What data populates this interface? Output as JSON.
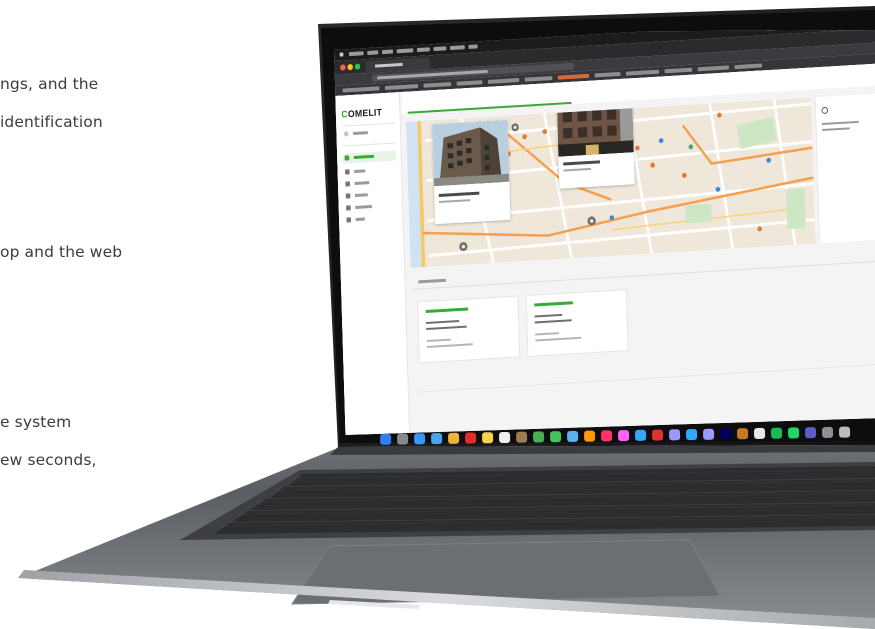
{
  "marketing_copy": {
    "line1": "ngs, and the",
    "line2": "identification",
    "line3": "op and the web",
    "line4": "e system",
    "line5": "ew seconds,"
  },
  "browser": {
    "tab_title": "",
    "url": ""
  },
  "app": {
    "logo": {
      "prefix": "C",
      "rest": "OMELIT"
    },
    "sidebar": {
      "profile_label": "",
      "items": [
        {
          "label": "",
          "active": true
        },
        {
          "label": "",
          "active": false
        },
        {
          "label": "",
          "active": false
        },
        {
          "label": "",
          "active": false
        },
        {
          "label": "",
          "active": false
        },
        {
          "label": "",
          "active": false
        }
      ]
    },
    "page_title": "",
    "map": {
      "cards": [
        {
          "title": "",
          "subtitle": ""
        },
        {
          "title": "",
          "subtitle": ""
        }
      ]
    },
    "section_label": "",
    "buildings": [
      {
        "name": "",
        "address_line1": "",
        "address_line2": "",
        "status": "",
        "meta": ""
      },
      {
        "name": "",
        "address_line1": "",
        "address_line2": "",
        "status": "",
        "meta": ""
      }
    ]
  },
  "colors": {
    "accent_green": "#3aaa35",
    "map_background": "#eee7da",
    "laptop_aluminium": "#b9bbbf",
    "screen_bezel": "#0d0d0f"
  },
  "dock_icons": [
    "finder-icon",
    "launchpad-icon",
    "safari-icon",
    "mail-icon",
    "photos-icon",
    "opera-icon",
    "notes-icon",
    "calendar-icon",
    "contacts-icon",
    "maps-icon",
    "messages-icon",
    "preview-icon",
    "illustrator-icon",
    "indesign-icon",
    "xd-icon",
    "lightroom-icon",
    "acrobat-icon",
    "aftereffects-icon",
    "photoshop-icon",
    "premiere-icon",
    "animate-icon",
    "bridge-icon",
    "chrome-icon",
    "spotify-icon",
    "whatsapp-icon",
    "teams-icon",
    "settings-icon",
    "trash-icon"
  ]
}
